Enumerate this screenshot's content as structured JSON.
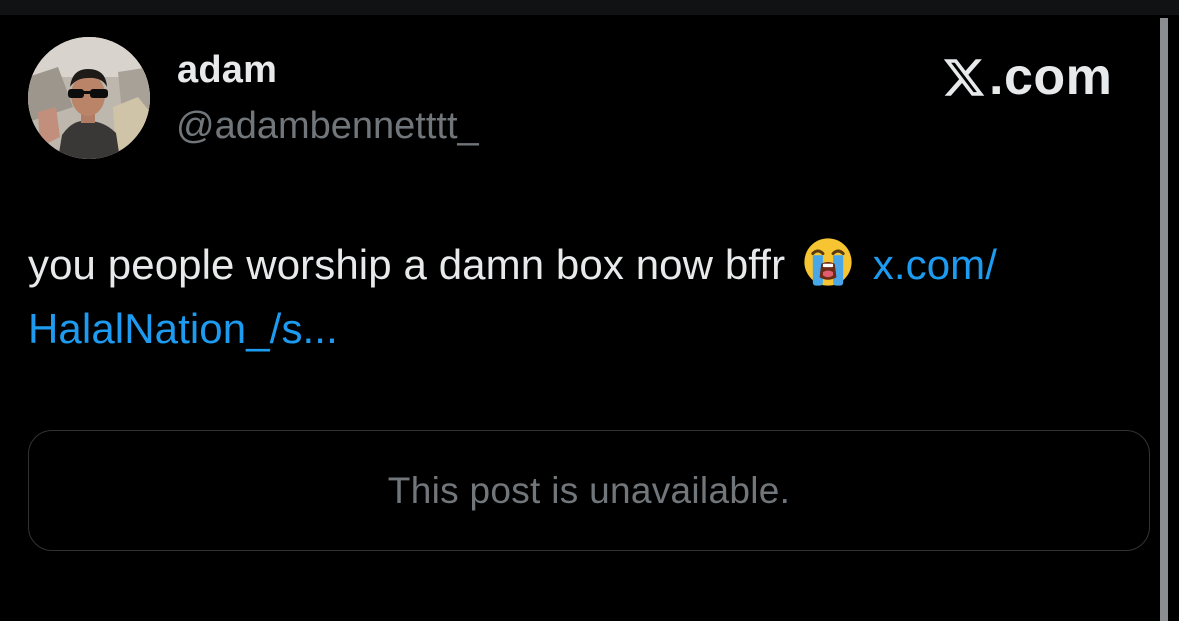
{
  "author": {
    "display_name": "adam",
    "handle": "@adambennetttt_"
  },
  "brand": {
    "icon": "x-logo-icon",
    "domain": ".com"
  },
  "tweet": {
    "text": "you people worship a damn box now bffr",
    "emoji": "loudly-crying-face-icon",
    "link_line1": "x.com/",
    "link_line2": "HalalNation_/s..."
  },
  "quoted_post": {
    "message": "This post is unavailable."
  },
  "colors": {
    "background": "#000000",
    "text_primary": "#e7e9ea",
    "text_secondary": "#71767b",
    "link": "#1d9bf0",
    "border": "#2f3336"
  }
}
